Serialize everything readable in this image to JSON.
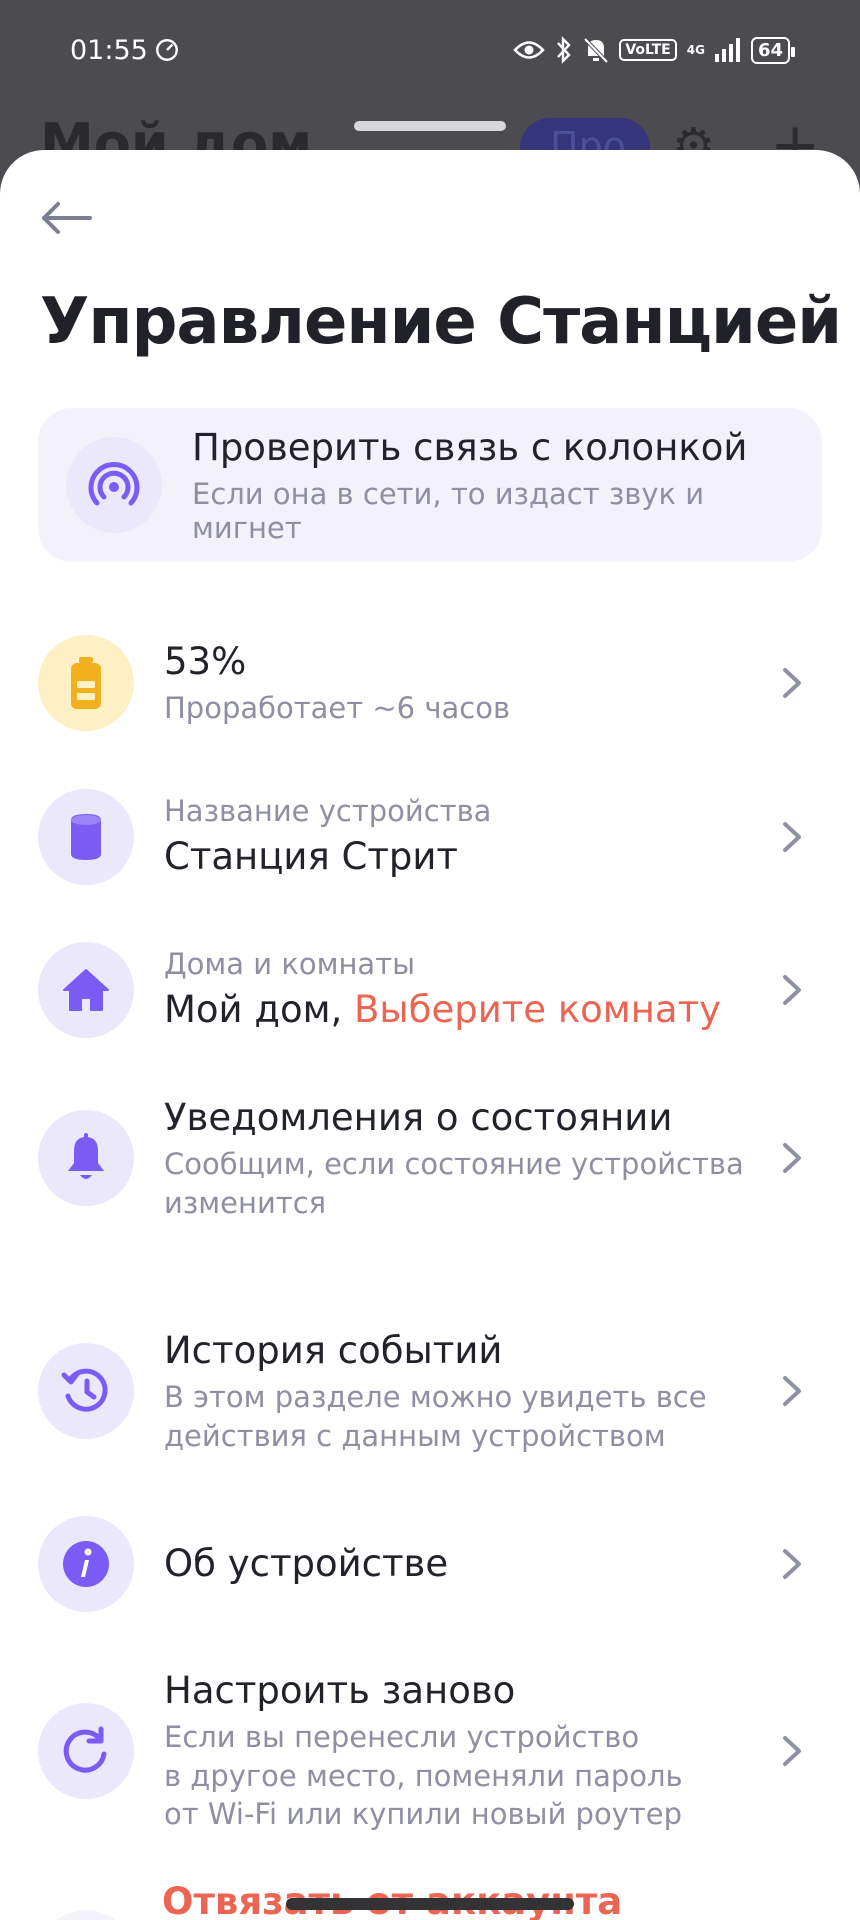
{
  "status_bar": {
    "time": "01:55",
    "volte": "VoLTE",
    "network": "4G",
    "battery": "64"
  },
  "background": {
    "title": "Мой дом",
    "pill": "Про"
  },
  "sheet": {
    "title": "Управление Станцией",
    "check": {
      "title": "Проверить связь с колонкой",
      "subtitle": "Если она в сети, то издаст звук и мигнет"
    },
    "battery": {
      "value": "53%",
      "subtitle": "Проработает ~6 часов"
    },
    "device_name": {
      "label": "Название устройства",
      "value": "Станция Стрит"
    },
    "homes": {
      "label": "Дома и комнаты",
      "home": "Мой дом,",
      "room": "Выберите комнату"
    },
    "notifications": {
      "title": "Уведомления о состоянии",
      "subtitle_line1": "Сообщим, если состояние устройства",
      "subtitle_line2": "изменится"
    },
    "history": {
      "title": "История событий",
      "subtitle_line1": "В этом разделе можно увидеть все",
      "subtitle_line2": "действия с данным устройством"
    },
    "about": {
      "title": "Об устройстве"
    },
    "reset": {
      "title": "Настроить заново",
      "subtitle_line1": "Если вы перенесли устройство",
      "subtitle_line2": "в другое место, поменяли пароль",
      "subtitle_line3": "от Wi-Fi или купили новый роутер"
    },
    "unlink": {
      "title": "Отвязать от аккаунта"
    }
  },
  "colors": {
    "accent_purple": "#7a5cf5",
    "accent_red": "#ec6552",
    "battery_yellow": "#f2b01e"
  }
}
